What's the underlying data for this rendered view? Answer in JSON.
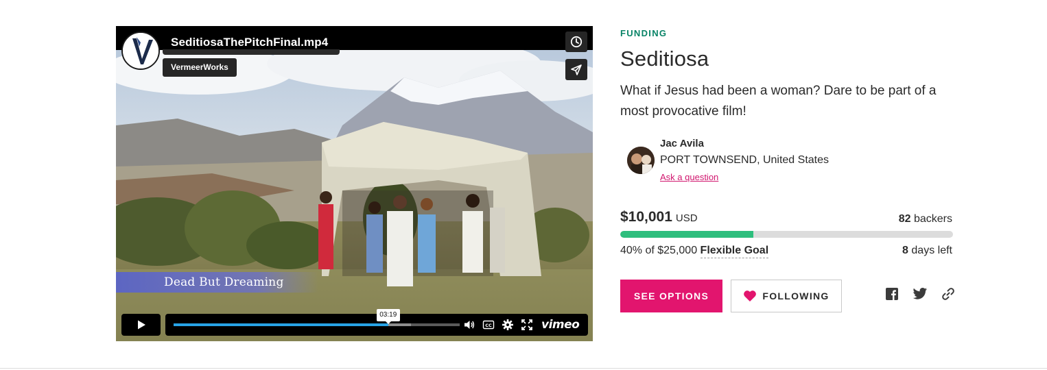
{
  "video": {
    "title": "SeditiosaThePitchFinal.mp4",
    "owner": "VermeerWorks",
    "caption": "Dead But Dreaming",
    "timestamp": "03:19",
    "progress_played": 0.75,
    "progress_loaded": 0.83,
    "brand": "vimeo"
  },
  "project": {
    "status": "FUNDING",
    "title": "Seditiosa",
    "tagline": "What if Jesus had been a woman? Dare to be part of a most provocative film!",
    "creator": {
      "name": "Jac Avila",
      "location": "PORT TOWNSEND, United States",
      "ask_label": "Ask a question"
    },
    "funding": {
      "raised": "$10,001",
      "currency": "USD",
      "backers_count": "82",
      "backers_label": "backers",
      "percent_text": "40% of $25,000",
      "percent": 0.4,
      "goal_type": "Flexible Goal",
      "days_count": "8",
      "days_label": "days left"
    },
    "actions": {
      "see_options": "SEE OPTIONS",
      "following": "FOLLOWING"
    },
    "social": [
      "facebook-icon",
      "twitter-icon",
      "link-icon"
    ]
  },
  "colors": {
    "accent_pink": "#e2156e",
    "status_green": "#088366",
    "progress_green": "#2ebe7d",
    "player_blue": "#27a3e6"
  }
}
